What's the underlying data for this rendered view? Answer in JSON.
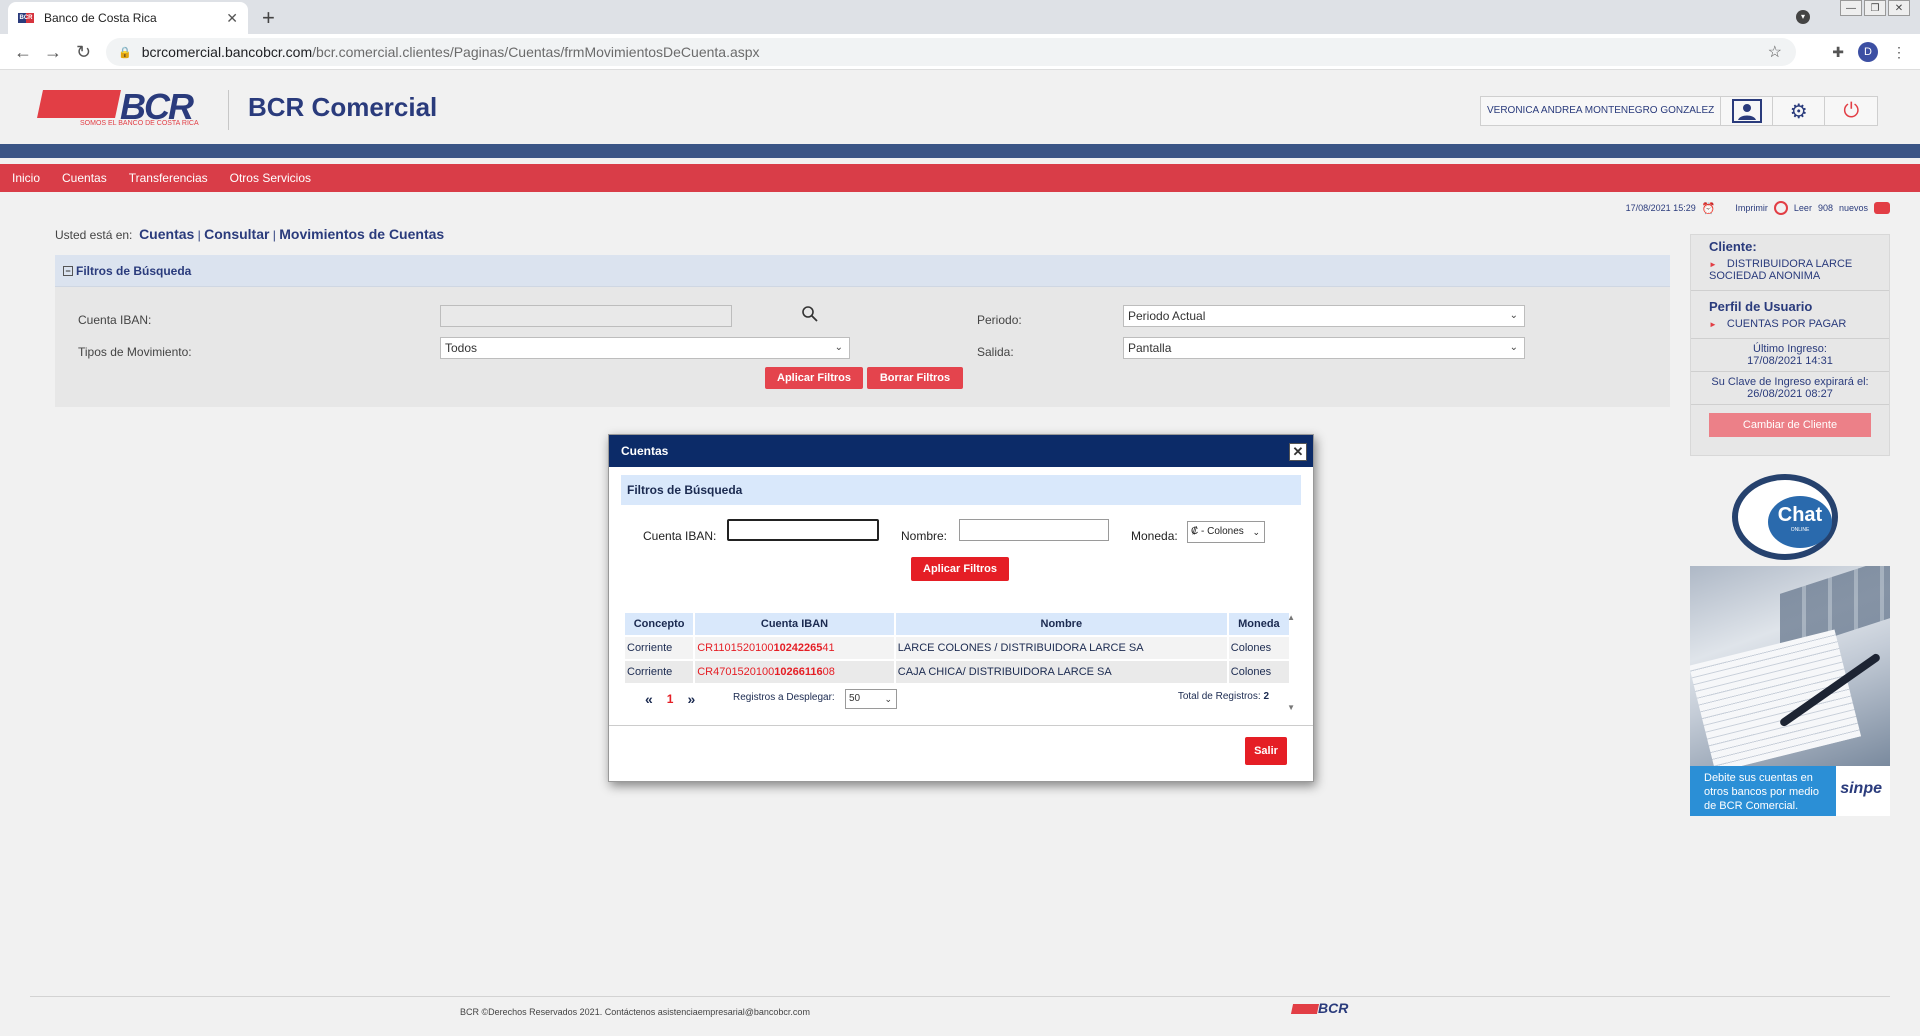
{
  "browser": {
    "tab_title": "Banco de Costa Rica",
    "tab_close": "✕",
    "new_tab": "+",
    "url_host": "bcrcomercial.bancobcr.com",
    "url_path": "/bcr.comercial.clientes/Paginas/Cuentas/frmMovimientosDeCuenta.aspx",
    "profile_initial": "D"
  },
  "header": {
    "logo_text": "BCR",
    "logo_sub": "SOMOS EL BANCO DE COSTA RICA",
    "brand": "BCR Comercial",
    "user_name": "VERONICA ANDREA MONTENEGRO GONZALEZ"
  },
  "nav": {
    "items": [
      "Inicio",
      "Cuentas",
      "Transferencias",
      "Otros Servicios"
    ]
  },
  "infoline": {
    "datetime": "17/08/2021 15:29",
    "print": "Imprimir",
    "read": "Leer",
    "count": "908",
    "new": "nuevos"
  },
  "breadcrumb": {
    "prefix": "Usted está en:",
    "items": [
      "Cuentas",
      "Consultar",
      "Movimientos de Cuentas"
    ],
    "sep": "|"
  },
  "filters": {
    "title": "Filtros de Búsqueda",
    "iban_label": "Cuenta IBAN:",
    "tipos_label": "Tipos de Movimiento:",
    "tipos_value": "Todos",
    "periodo_label": "Periodo:",
    "periodo_value": "Periodo Actual",
    "salida_label": "Salida:",
    "salida_value": "Pantalla",
    "apply": "Aplicar Filtros",
    "clear": "Borrar Filtros"
  },
  "sidebar": {
    "client_title": "Cliente:",
    "client_value": "DISTRIBUIDORA LARCE SOCIEDAD ANONIMA",
    "profile_title": "Perfil de Usuario",
    "profile_value": "CUENTAS POR PAGAR",
    "last_login_label": "Último Ingreso:",
    "last_login_value": "17/08/2021 14:31",
    "expiry_text": "Su Clave de Ingreso expirará el: 26/08/2021 08:27",
    "change_client": "Cambiar de Cliente",
    "chat": "Chat",
    "chat_sub": "ONLINE",
    "promo": "Debite sus cuentas en otros bancos por medio de BCR Comercial.",
    "sinpe": "sinpe"
  },
  "modal": {
    "title": "Cuentas",
    "close": "✕",
    "filter_title": "Filtros de Búsqueda",
    "iban_label": "Cuenta IBAN:",
    "iban_value": "",
    "name_label": "Nombre:",
    "name_value": "",
    "currency_label": "Moneda:",
    "currency_value": "₡ - Colones",
    "apply": "Aplicar Filtros",
    "columns": [
      "Concepto",
      "Cuenta IBAN",
      "Nombre",
      "Moneda"
    ],
    "rows": [
      {
        "concepto": "Corriente",
        "iban_prefix": "CR1101520100",
        "iban_bold": "10242265",
        "iban_suffix": "41",
        "nombre": "LARCE COLONES / DISTRIBUIDORA LARCE SA",
        "moneda": "Colones"
      },
      {
        "concepto": "Corriente",
        "iban_prefix": "CR4701520100",
        "iban_bold": "10266116",
        "iban_suffix": "08",
        "nombre": "CAJA CHICA/ DISTRIBUIDORA LARCE SA",
        "moneda": "Colones"
      }
    ],
    "pager_first": "«",
    "pager_current": "1",
    "pager_last": "»",
    "per_page_label": "Registros a Desplegar:",
    "per_page_value": "50",
    "total_label": "Total de Registros:",
    "total_value": "2",
    "exit": "Salir"
  },
  "footer": {
    "text": "BCR ©Derechos Reservados 2021. Contáctenos asistenciaempresarial@bancobcr.com",
    "logo": "BCR"
  },
  "colors": {
    "brand_blue": "#2a3b7c",
    "brand_red": "#d93d48",
    "modal_header": "#0c2b68"
  }
}
